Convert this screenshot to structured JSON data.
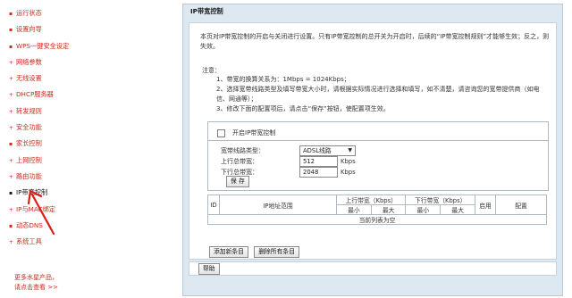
{
  "sidebar": {
    "items": [
      {
        "label": "运行状态"
      },
      {
        "label": "设置向导"
      },
      {
        "label": "WPS一键安全设定"
      },
      {
        "label": "网络参数"
      },
      {
        "label": "无线设置"
      },
      {
        "label": "DHCP服务器"
      },
      {
        "label": "转发规则"
      },
      {
        "label": "安全功能"
      },
      {
        "label": "家长控制"
      },
      {
        "label": "上网控制"
      },
      {
        "label": "路由功能"
      },
      {
        "label": "IP带宽控制"
      },
      {
        "label": "IP与MAC绑定"
      },
      {
        "label": "动态DNS"
      },
      {
        "label": "系统工具"
      }
    ],
    "promo_line1": "更多水星产品，",
    "promo_line2": "请点击查看 >>"
  },
  "page": {
    "title": "IP带宽控制",
    "intro": "本页对IP带宽控制的开启与关闭进行设置。只有IP带宽控制的总开关为开启时，后续的“IP带宽控制规则”才能够生效；反之，则失效。",
    "note_label": "注意：",
    "notes": [
      "1、带宽的换算关系为：1Mbps = 1024Kbps；",
      "2、选择宽带线路类型及填写带宽大小时，请根据实际情况进行选择和填写，如不清楚，请咨询您的宽带提供商（如电信、网通等）；",
      "3、修改下面的配置项后，请点击“保存”按钮，使配置项生效。"
    ]
  },
  "settings": {
    "enable_label": "开启IP带宽控制",
    "line_type_label": "宽带线路类型：",
    "line_type_value": "ADSL线路",
    "upload_label": "上行总带宽：",
    "upload_value": "512",
    "download_label": "下行总带宽：",
    "download_value": "2048",
    "unit": "Kbps",
    "save_label": "保 存"
  },
  "table": {
    "col_id": "ID",
    "col_ip": "IP地址范围",
    "col_up": "上行带宽（Kbps）",
    "col_down": "下行带宽（Kbps）",
    "col_enable": "启用",
    "col_config": "配置",
    "col_min": "最小",
    "col_max": "最大",
    "empty_text": "当前列表为空"
  },
  "actions": {
    "add_label": "添加新条目",
    "delete_all_label": "删除所有条目",
    "help_label": "帮助"
  },
  "colors": {
    "nav_text": "#cc2a1a",
    "panel_bg": "#dde8f0",
    "arrow": "#d8201a"
  }
}
